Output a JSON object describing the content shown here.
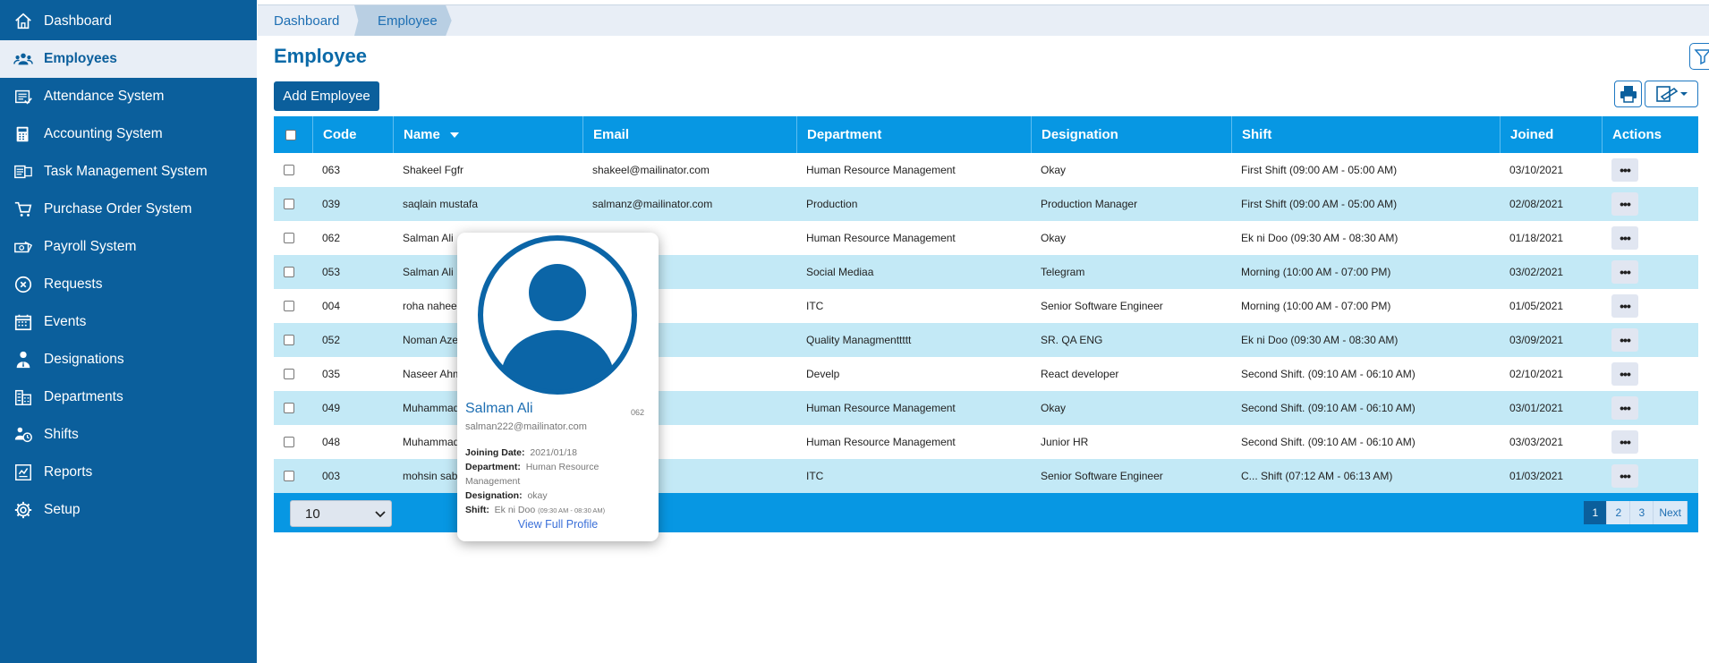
{
  "sidebar": {
    "items": [
      {
        "label": "Dashboard",
        "icon": "home-icon",
        "active": false
      },
      {
        "label": "Employees",
        "icon": "users-icon",
        "active": true
      },
      {
        "label": "Attendance System",
        "icon": "attendance-icon",
        "active": false
      },
      {
        "label": "Accounting System",
        "icon": "accounting-icon",
        "active": false
      },
      {
        "label": "Task Management System",
        "icon": "task-icon",
        "active": false
      },
      {
        "label": "Purchase Order System",
        "icon": "cart-icon",
        "active": false
      },
      {
        "label": "Payroll System",
        "icon": "payroll-icon",
        "active": false
      },
      {
        "label": "Requests",
        "icon": "requests-icon",
        "active": false
      },
      {
        "label": "Events",
        "icon": "calendar-icon",
        "active": false
      },
      {
        "label": "Designations",
        "icon": "designation-icon",
        "active": false
      },
      {
        "label": "Departments",
        "icon": "building-icon",
        "active": false
      },
      {
        "label": "Shifts",
        "icon": "shifts-icon",
        "active": false
      },
      {
        "label": "Reports",
        "icon": "reports-icon",
        "active": false
      },
      {
        "label": "Setup",
        "icon": "gear-icon",
        "active": false
      }
    ]
  },
  "breadcrumb": {
    "items": [
      "Dashboard",
      "Employee"
    ]
  },
  "page": {
    "title": "Employee",
    "add_button": "Add Employee"
  },
  "table": {
    "columns": [
      "Code",
      "Name",
      "Email",
      "Department",
      "Designation",
      "Shift",
      "Joined",
      "Actions"
    ],
    "rows": [
      {
        "code": "063",
        "name": "Shakeel Fgfr",
        "email": "shakeel@mailinator.com",
        "department": "Human Resource Management",
        "designation": "Okay",
        "shift": "First Shift (09:00 AM - 05:00 AM)",
        "joined": "03/10/2021"
      },
      {
        "code": "039",
        "name": "saqlain mustafa",
        "email": "salmanz@mailinator.com",
        "department": "Production",
        "designation": "Production Manager",
        "shift": "First Shift (09:00 AM - 05:00 AM)",
        "joined": "02/08/2021"
      },
      {
        "code": "062",
        "name": "Salman Ali",
        "email": "ailinator.com",
        "department": "Human Resource Management",
        "designation": "Okay",
        "shift": "Ek ni Doo (09:30 AM - 08:30 AM)",
        "joined": "01/18/2021"
      },
      {
        "code": "053",
        "name": "Salman Ali F",
        "email": "ilinator.com",
        "department": "Social Mediaa",
        "designation": "Telegram",
        "shift": "Morning (10:00 AM - 07:00 PM)",
        "joined": "03/02/2021"
      },
      {
        "code": "004",
        "name": "roha nahee",
        "email": "tor.com",
        "department": "ITC",
        "designation": "Senior Software Engineer",
        "shift": "Morning (10:00 AM - 07:00 PM)",
        "joined": "01/05/2021"
      },
      {
        "code": "052",
        "name": "Noman Aze",
        "email": "nator.com",
        "department": "Quality Managmenttttt",
        "designation": "SR. QA ENG",
        "shift": "Ek ni Doo (09:30 AM - 08:30 AM)",
        "joined": "03/09/2021"
      },
      {
        "code": "035",
        "name": "Naseer Ahm",
        "email": "nator.com",
        "department": "Develp",
        "designation": "React developer",
        "shift": "Second Shift. (09:10 AM - 06:10 AM)",
        "joined": "02/10/2021"
      },
      {
        "code": "049",
        "name": "Muhammad",
        "email": "tor.com",
        "department": "Human Resource Management",
        "designation": "Okay",
        "shift": "Second Shift. (09:10 AM - 06:10 AM)",
        "joined": "03/01/2021"
      },
      {
        "code": "048",
        "name": "Muhammad",
        "email": "tor.com",
        "department": "Human Resource Management",
        "designation": "Junior HR",
        "shift": "Second Shift. (09:10 AM - 06:10 AM)",
        "joined": "03/03/2021"
      },
      {
        "code": "003",
        "name": "mohsin sabi",
        "email": "inator.com",
        "department": "ITC",
        "designation": "Senior Software Engineer",
        "shift": "C... Shift (07:12 AM - 06:13 AM)",
        "joined": "01/03/2021"
      }
    ],
    "action_label": "•••",
    "page_size": "10",
    "pagination": [
      "1",
      "2",
      "3",
      "Next"
    ],
    "active_page": "1"
  },
  "popup": {
    "name": "Salman Ali",
    "code": "062",
    "email": "salman222@mailinator.com",
    "joining_label": "Joining Date:",
    "joining_value": "2021/01/18",
    "department_label": "Department:",
    "department_value": "Human Resource Management",
    "designation_label": "Designation:",
    "designation_value": "okay",
    "shift_label": "Shift:",
    "shift_value": "Ek ni Doo",
    "shift_time": "(09:30 AM - 08:30 AM)",
    "link": "View Full Profile"
  },
  "colors": {
    "sidebar": "#0b5f9c",
    "header": "#0797e3",
    "row_alt": "#c3e9f6",
    "accent": "#1e6fb3"
  }
}
